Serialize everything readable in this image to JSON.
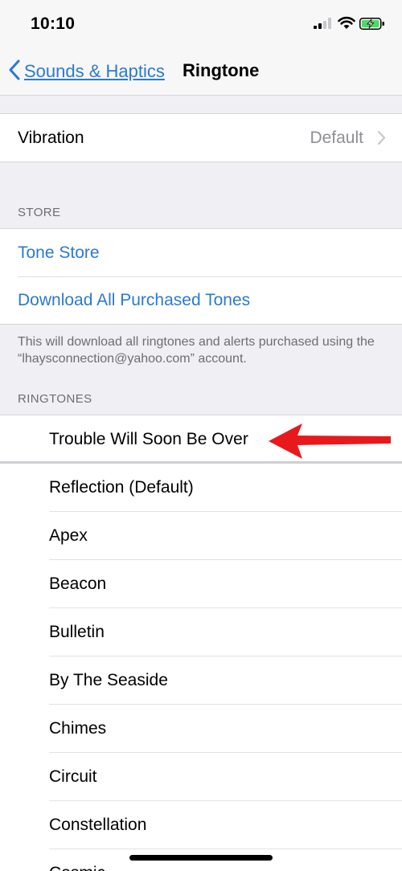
{
  "status_bar": {
    "time": "10:10",
    "icons": [
      "signal-icon",
      "wifi-icon",
      "battery-charging-icon"
    ]
  },
  "nav": {
    "back_label": "Sounds & Haptics",
    "title": "Ringtone"
  },
  "vibration": {
    "label": "Vibration",
    "value": "Default"
  },
  "store": {
    "header": "STORE",
    "tone_store": "Tone Store",
    "download_all": "Download All Purchased Tones",
    "footer": "This will download all ringtones and alerts purchased using the “lhaysconnection@yahoo.com” account."
  },
  "ringtones": {
    "header": "RINGTONES",
    "items": [
      "Trouble Will Soon Be Over",
      "Reflection (Default)",
      "Apex",
      "Beacon",
      "Bulletin",
      "By The Seaside",
      "Chimes",
      "Circuit",
      "Constellation",
      "Cosmic"
    ]
  },
  "colors": {
    "accent": "#2a7ad1",
    "annotation_arrow": "#e8191c",
    "background": "#efeff4",
    "battery": "#4cd964"
  }
}
